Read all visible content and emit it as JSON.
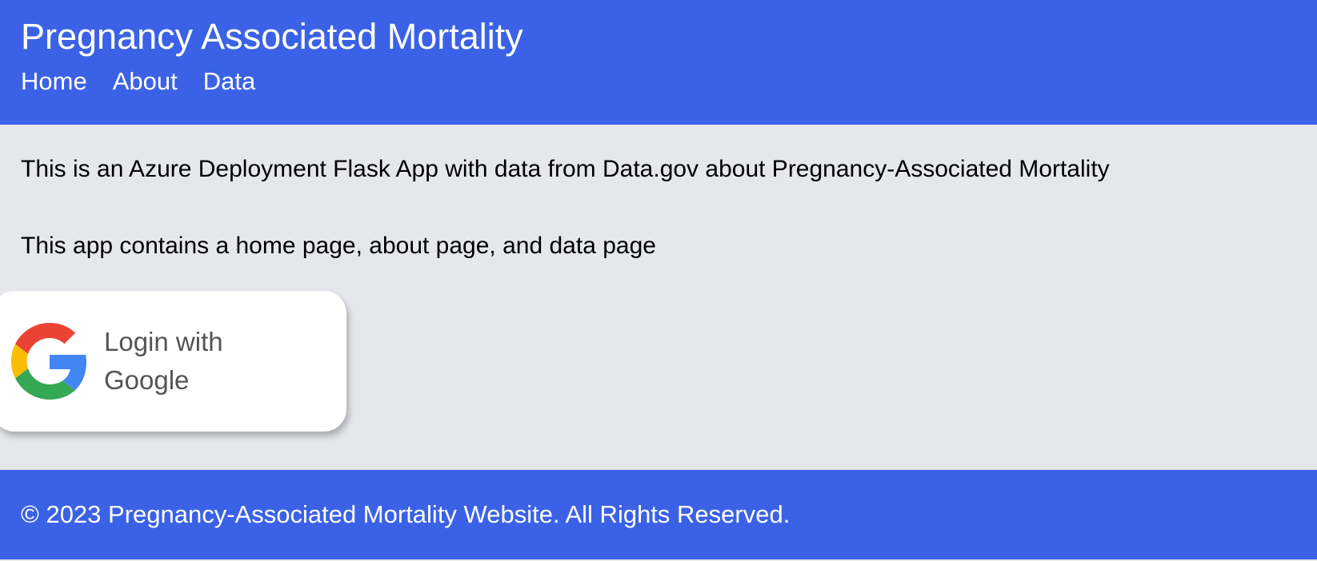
{
  "header": {
    "title": "Pregnancy Associated Mortality",
    "nav": [
      {
        "label": "Home"
      },
      {
        "label": "About"
      },
      {
        "label": "Data"
      }
    ]
  },
  "main": {
    "intro_line_1": "This is an Azure Deployment Flask App with data from Data.gov about Pregnancy-Associated Mortality",
    "intro_line_2": "This app contains a home page, about page, and data page",
    "login_button": {
      "label_line_1": "Login with",
      "label_line_2": "Google",
      "icon": "google-g-icon"
    }
  },
  "footer": {
    "copyright": "© 2023 Pregnancy-Associated Mortality Website. All Rights Reserved."
  },
  "colors": {
    "brand_blue": "#3b62e6",
    "page_bg": "#e5e7eb",
    "button_bg": "#ffffff",
    "google_red": "#ea4335",
    "google_yellow": "#fbbc05",
    "google_green": "#34a853",
    "google_blue": "#4285f4"
  }
}
